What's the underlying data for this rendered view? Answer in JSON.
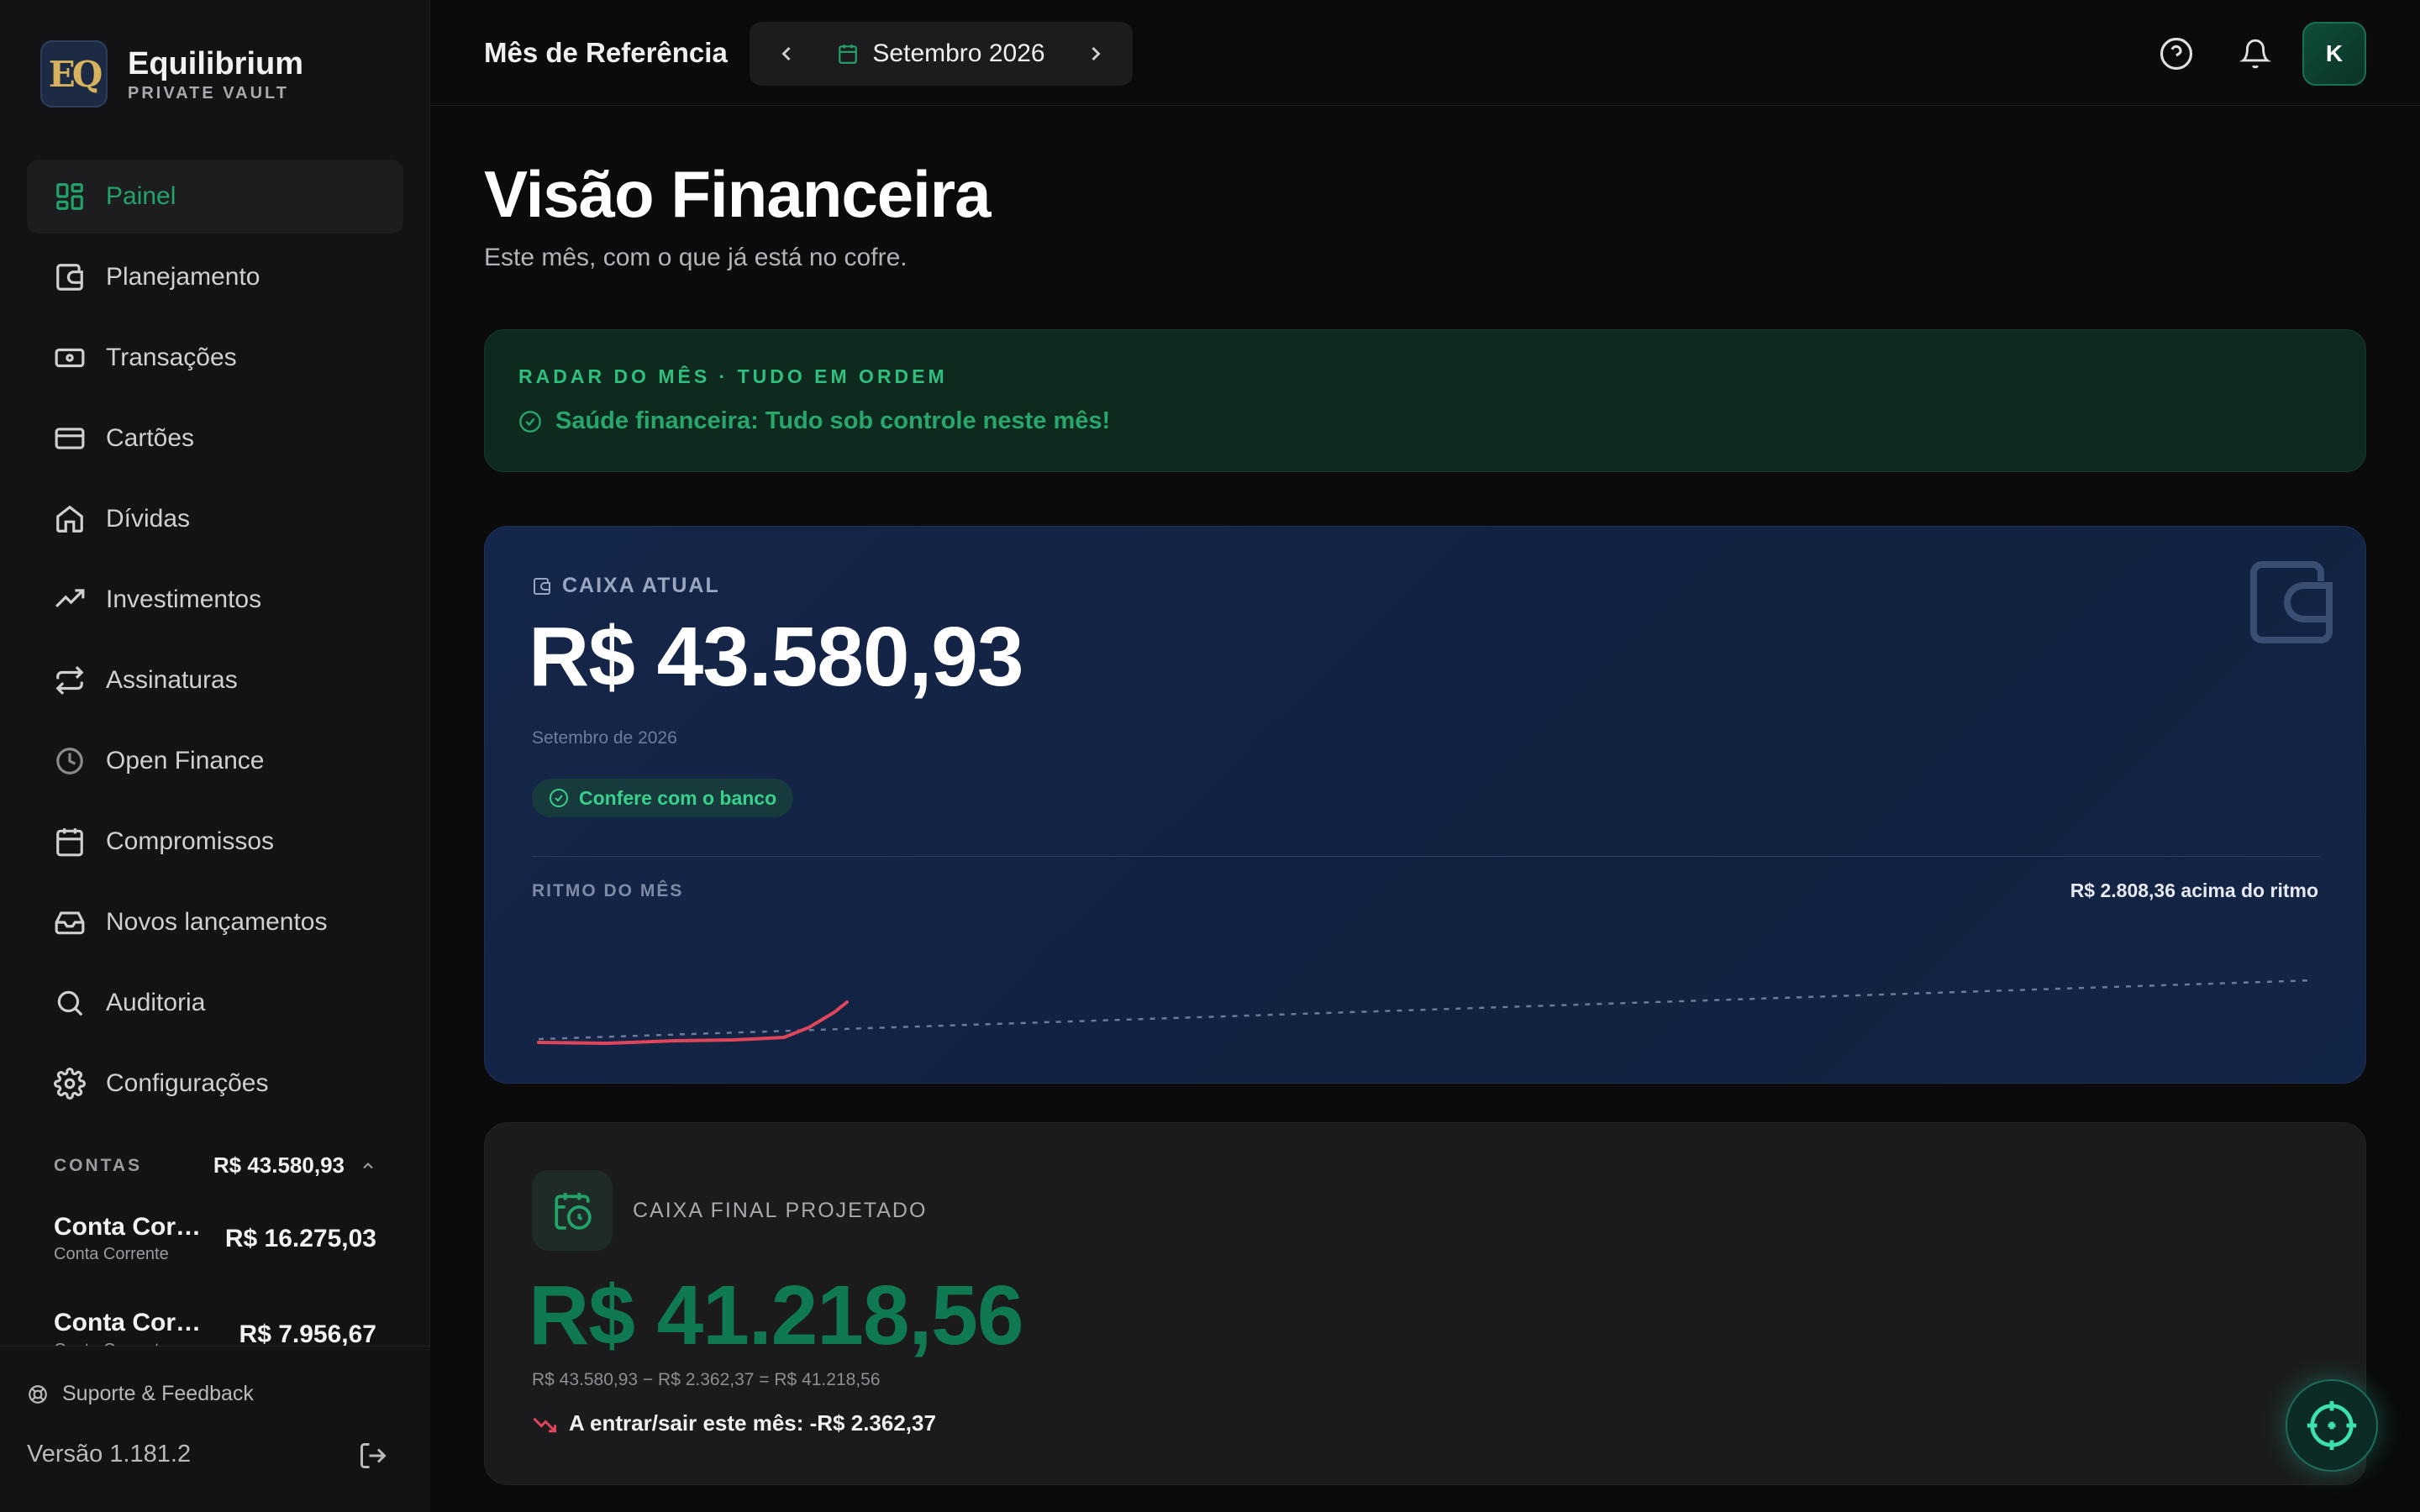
{
  "brand": {
    "name": "Equilibrium",
    "subtitle": "PRIVATE VAULT",
    "logo_text": "EQ"
  },
  "sidebar": {
    "items": [
      {
        "label": "Painel",
        "icon": "dashboard-icon",
        "active": true
      },
      {
        "label": "Planejamento",
        "icon": "wallet-icon"
      },
      {
        "label": "Transações",
        "icon": "banknote-icon"
      },
      {
        "label": "Cartões",
        "icon": "credit-card-icon"
      },
      {
        "label": "Dívidas",
        "icon": "home-icon"
      },
      {
        "label": "Investimentos",
        "icon": "trending-up-icon"
      },
      {
        "label": "Assinaturas",
        "icon": "repeat-icon"
      },
      {
        "label": "Open Finance",
        "icon": "open-finance-icon"
      },
      {
        "label": "Compromissos",
        "icon": "calendar-icon"
      },
      {
        "label": "Novos lançamentos",
        "icon": "inbox-icon"
      },
      {
        "label": "Auditoria",
        "icon": "search-icon"
      },
      {
        "label": "Configurações",
        "icon": "gear-icon"
      }
    ],
    "accounts": {
      "label": "CONTAS",
      "total": "R$ 43.580,93",
      "items": [
        {
          "name": "Conta Corrente",
          "type": "Conta Corrente",
          "value": "R$ 16.275,03"
        },
        {
          "name": "Conta Corrente",
          "type": "Conta Corrente",
          "value": "R$ 7.956,67"
        }
      ]
    },
    "support": "Suporte & Feedback",
    "version": "Versão 1.181.2"
  },
  "topbar": {
    "reference_label": "Mês de Referência",
    "month": "Setembro 2026"
  },
  "user": {
    "initial": "K"
  },
  "page": {
    "title": "Visão Financeira",
    "subtitle": "Este mês, com o que já está no cofre."
  },
  "radar": {
    "title": "RADAR DO MÊS · TUDO EM ORDEM",
    "message": "Saúde financeira: Tudo sob controle neste mês!"
  },
  "cash": {
    "label": "CAIXA ATUAL",
    "value": "R$ 43.580,93",
    "date": "Setembro de 2026",
    "badge": "Confere com o banco",
    "pace_label": "RITMO DO MÊS",
    "pace_delta": "R$ 2.808,36 acima do ritmo"
  },
  "projected": {
    "label": "CAIXA FINAL PROJETADO",
    "value": "R$ 41.218,56",
    "formula": "R$ 43.580,93 − R$ 2.362,37 = R$ 41.218,56",
    "flow": "A entrar/sair este mês: -R$ 2.362,37"
  },
  "colors": {
    "accent": "#22a36a",
    "danger": "#e0465a",
    "navy": "#14264a"
  }
}
